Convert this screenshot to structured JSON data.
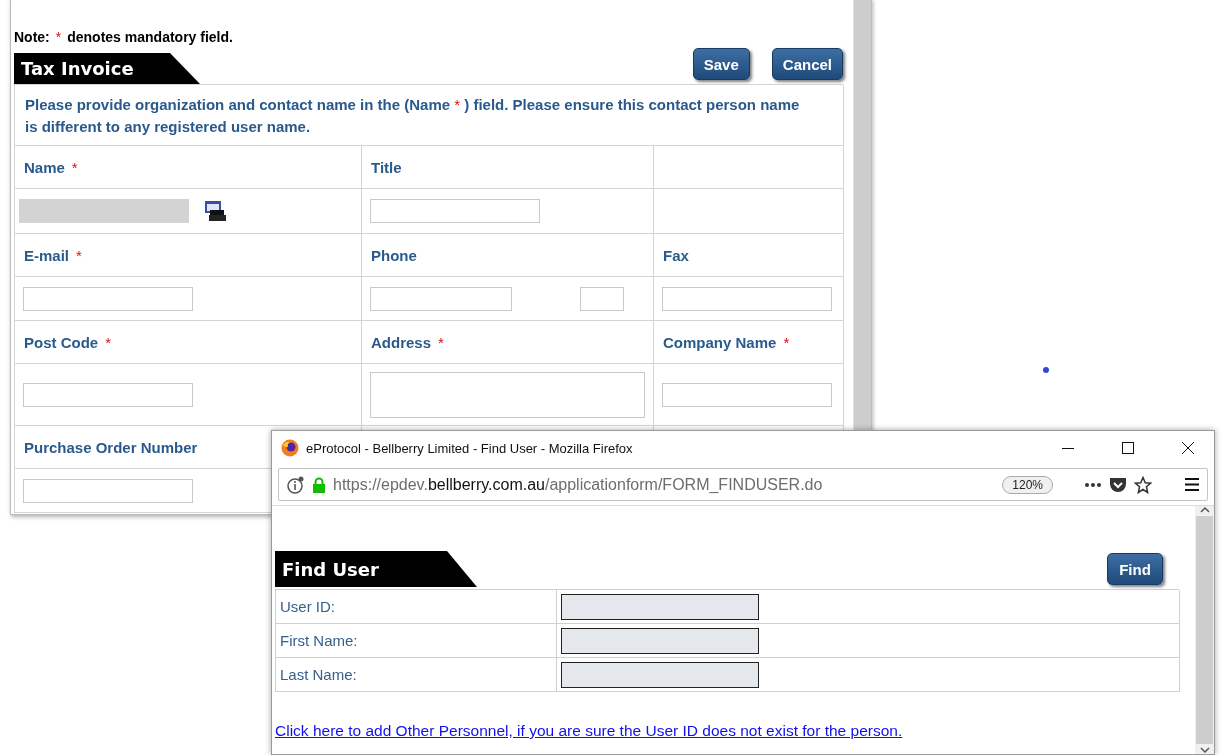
{
  "note": {
    "label": "Note:",
    "mark": "*",
    "text": "denotes mandatory field."
  },
  "form": {
    "title": "Tax Invoice",
    "buttons": [
      "Save",
      "Cancel"
    ],
    "message": {
      "before": "Please provide organization and contact name in the (Name ",
      "mark": "*",
      "after": " ) field. Please ensure this contact person name is different to any registered user name."
    },
    "rows": [
      [
        {
          "label": "Name",
          "mark": "*",
          "kind": "lookup",
          "disabled": true
        },
        {
          "label": "Title",
          "kind": "text"
        },
        {
          "kind": "none"
        }
      ],
      [
        {
          "label": "E-mail",
          "mark": "*",
          "kind": "text"
        },
        {
          "label": "Phone",
          "kind": "phone"
        },
        {
          "label": "Fax",
          "kind": "text"
        }
      ],
      [
        {
          "label": "Post Code",
          "mark": "*",
          "kind": "text"
        },
        {
          "label": "Address",
          "mark": "*",
          "kind": "textarea"
        },
        {
          "label": "Company Name",
          "mark": "*",
          "kind": "text"
        }
      ],
      [
        {
          "label": "Purchase Order Number",
          "kind": "text"
        }
      ]
    ]
  },
  "popup": {
    "title": "eProtocol - Bellberry Limited - Find User - Mozilla Firefox",
    "url": {
      "scheme": "https://epdev.",
      "domain": "bellberry.com.au",
      "path": "/applicationform/FORM_FINDUSER.do"
    },
    "zoom": "120%",
    "heading": "Find User",
    "button": "Find",
    "fields": [
      {
        "label": "User ID:"
      },
      {
        "label": "First Name:"
      },
      {
        "label": "Last Name:"
      }
    ],
    "link": "Click here to add Other Personnel, if you are sure the User ID does not exist for the person."
  }
}
